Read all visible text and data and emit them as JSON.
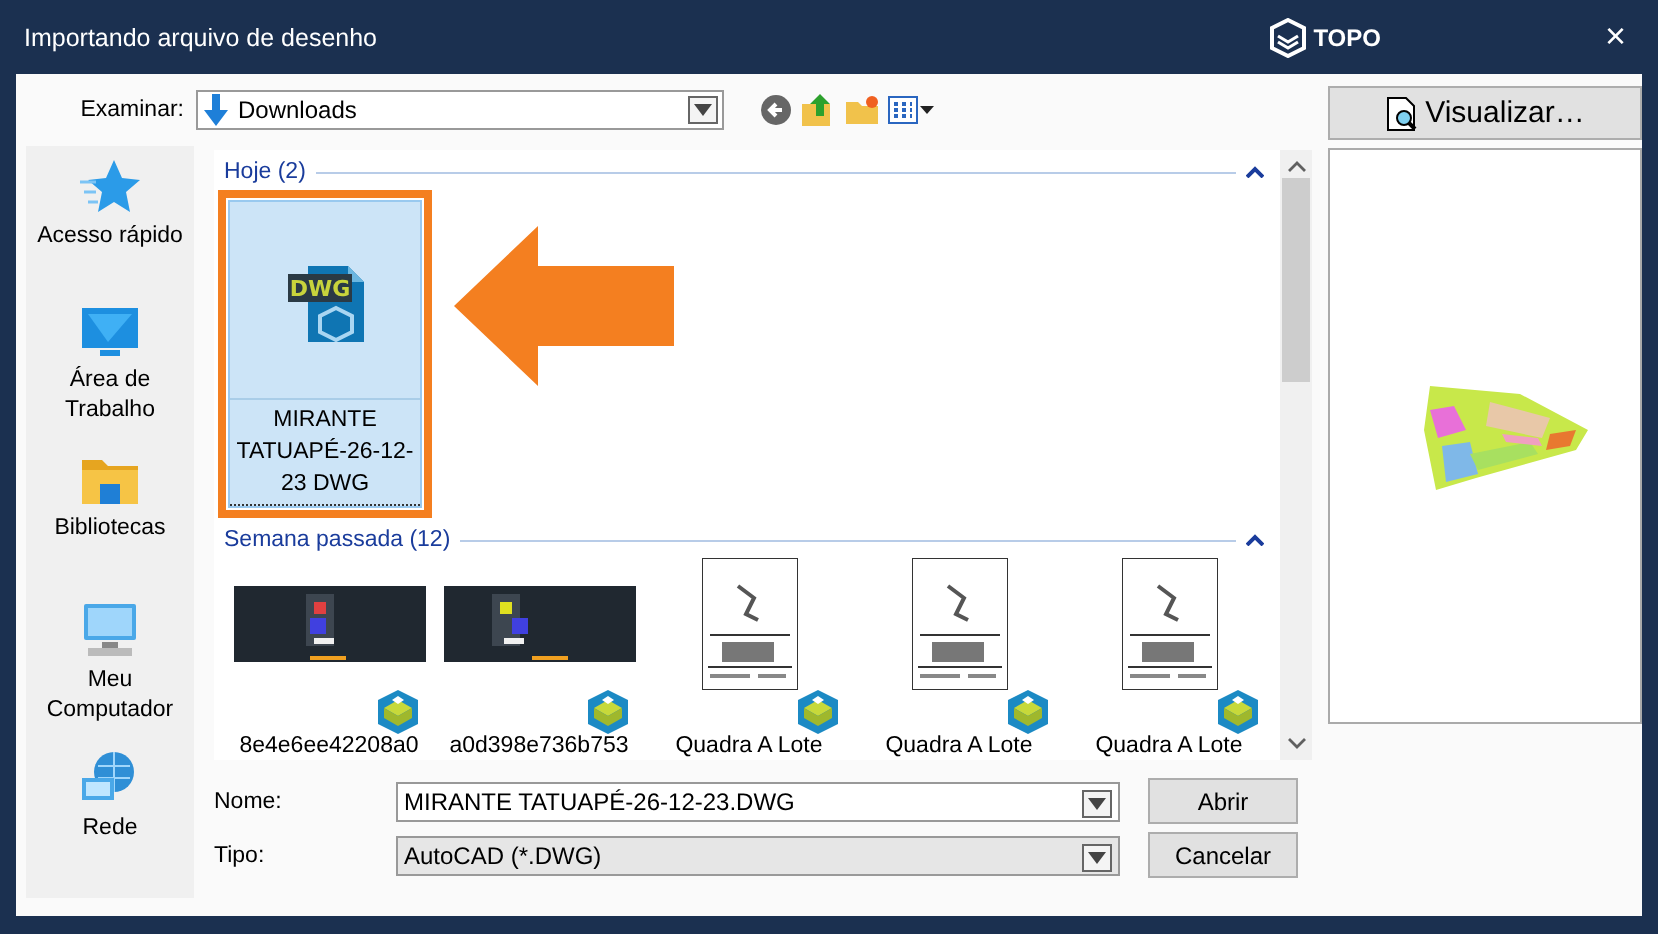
{
  "window": {
    "title": "Importando arquivo de desenho",
    "brand": "TOPO",
    "close": "×"
  },
  "toolbar": {
    "label": "Examinar:",
    "location": "Downloads"
  },
  "sidebar": {
    "items": [
      {
        "label": "Acesso rápido",
        "kind": "star"
      },
      {
        "label": "Área de Trabalho",
        "kind": "desktop"
      },
      {
        "label": "Bibliotecas",
        "kind": "folder"
      },
      {
        "label": "Meu Computador",
        "kind": "computer"
      },
      {
        "label": "Rede",
        "kind": "network"
      }
    ]
  },
  "groups": [
    {
      "title": "Hoje (2)",
      "expanded": true,
      "items": [
        {
          "name": "MIRANTE TATUAPÉ-26-12-23 DWG",
          "kind": "dwg",
          "icon_text": "DWG",
          "selected": true
        }
      ]
    },
    {
      "title": "Semana passada (12)",
      "expanded": true,
      "items": [
        {
          "name": "8e4e6ee42208a0",
          "kind": "dark",
          "selected": false
        },
        {
          "name": "a0d398e736b753",
          "kind": "dark2",
          "selected": false
        },
        {
          "name": "Quadra A Lote",
          "kind": "sheet",
          "selected": false
        },
        {
          "name": "Quadra A Lote",
          "kind": "sheet",
          "selected": false
        },
        {
          "name": "Quadra A Lote",
          "kind": "sheet",
          "selected": false
        }
      ]
    }
  ],
  "fields": [
    {
      "label": "Nome:",
      "value": "MIRANTE TATUAPÉ-26-12-23.DWG",
      "disabled": false
    },
    {
      "label": "Tipo:",
      "value": "AutoCAD (*.DWG)",
      "disabled": true
    }
  ],
  "buttons": [
    {
      "label": "Abrir"
    },
    {
      "label": "Cancelar"
    }
  ],
  "preview": {
    "button": "Visualizar…"
  }
}
